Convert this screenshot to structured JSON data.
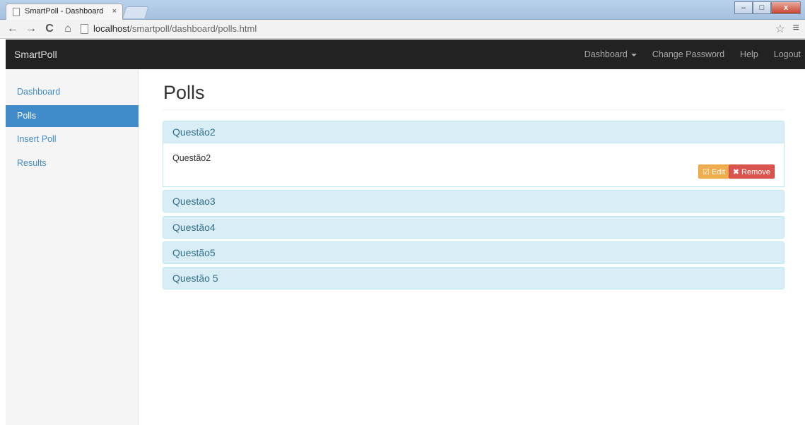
{
  "browser": {
    "tab_title": "SmartPoll - Dashboard",
    "tab_close": "×",
    "url_host": "localhost",
    "url_path": "/smartpoll/dashboard/polls.html",
    "nav": {
      "back": "←",
      "forward": "→",
      "reload": "C",
      "home": "⌂"
    },
    "bookmark": "☆",
    "menu": "≡",
    "window": {
      "minimize": "–",
      "maximize": "□",
      "close": "x"
    }
  },
  "navbar": {
    "brand": "SmartPoll",
    "links": [
      "Dashboard",
      "Change Password",
      "Help",
      "Logout"
    ]
  },
  "sidebar": {
    "items": [
      {
        "label": "Dashboard",
        "active": false
      },
      {
        "label": "Polls",
        "active": true
      },
      {
        "label": "Insert Poll",
        "active": false
      },
      {
        "label": "Results",
        "active": false
      }
    ]
  },
  "main": {
    "title": "Polls",
    "polls": [
      {
        "heading": "Questão2",
        "body": "Questão2",
        "expanded": true
      },
      {
        "heading": "Questao3",
        "expanded": false
      },
      {
        "heading": "Questão4",
        "expanded": false
      },
      {
        "heading": "Questão5",
        "expanded": false
      },
      {
        "heading": "Questão 5",
        "expanded": false
      }
    ],
    "edit_label": "Edit",
    "remove_label": "Remove",
    "edit_icon": "☑",
    "remove_icon": "✖"
  },
  "colors": {
    "navbar_bg": "#222222",
    "accent": "#428bca",
    "panel_head_bg": "#d9edf7",
    "panel_head_text": "#31708f",
    "edit_button": "#f0ad4e",
    "remove_button": "#d9534f"
  }
}
